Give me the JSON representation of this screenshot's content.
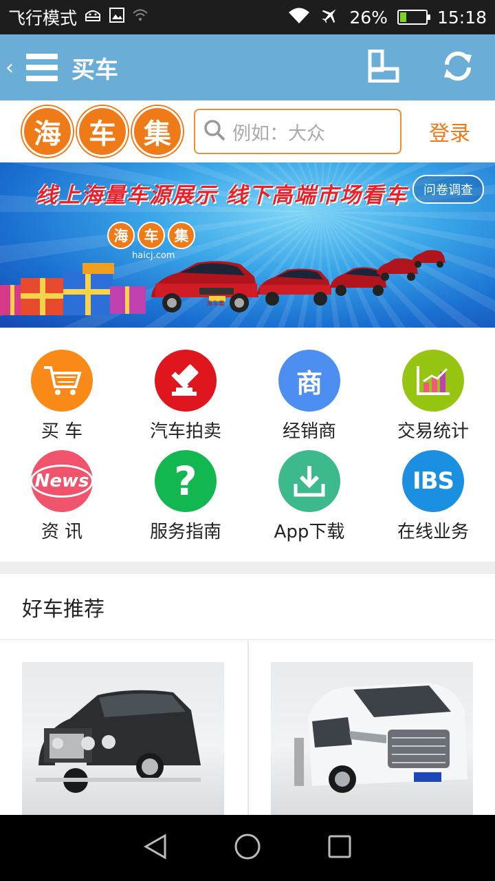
{
  "status_bar": {
    "airplane_mode_label": "飞行模式",
    "battery_percent": "26%",
    "battery_level": 0.26,
    "time": "15:18",
    "icons": [
      "android-debug-icon",
      "image-icon",
      "wifi-off-icon",
      "wifi-icon",
      "airplane-icon",
      "battery-charging-icon"
    ]
  },
  "app_bar": {
    "title": "买车",
    "icons": [
      "back-chevron-icon",
      "menu-icon",
      "layout-icon",
      "refresh-icon"
    ]
  },
  "header": {
    "logo": [
      "海",
      "车",
      "集"
    ],
    "search_placeholder": "例如：大众",
    "login_label": "登录"
  },
  "banner": {
    "slogan": "线上海量车源展示  线下高端市场看车",
    "survey_label": "问卷调查",
    "logo": [
      "海",
      "车",
      "集"
    ],
    "domain": "haicj.com",
    "plate_label": "海车集"
  },
  "features": [
    {
      "label": "买 车",
      "icon": "shopping-cart-icon",
      "color": "#f98a17"
    },
    {
      "label": "汽车拍卖",
      "icon": "auction-hammer-icon",
      "color": "#e0161e"
    },
    {
      "label": "经销商",
      "icon": "dealer-icon",
      "glyph": "商",
      "color": "#4d8ff0"
    },
    {
      "label": "交易统计",
      "icon": "stats-chart-icon",
      "color": "#96c512"
    },
    {
      "label": "资 讯",
      "icon": "news-icon",
      "glyph": "News",
      "color": "#f0536c"
    },
    {
      "label": "服务指南",
      "icon": "help-icon",
      "glyph": "?",
      "color": "#12b84f"
    },
    {
      "label": "App下载",
      "icon": "download-icon",
      "color": "#3dba8c"
    },
    {
      "label": "在线业务",
      "icon": "ibs-icon",
      "glyph": "IBS",
      "color": "#1b8fe0"
    }
  ],
  "recommend": {
    "title": "好车推荐"
  },
  "nav_bar": {
    "icons": [
      "back-triangle-icon",
      "home-circle-icon",
      "recents-square-icon"
    ]
  }
}
